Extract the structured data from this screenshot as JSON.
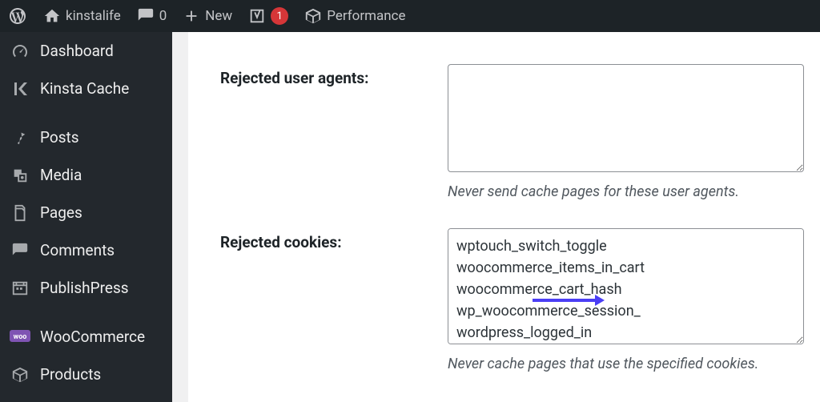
{
  "adminbar": {
    "site_title": "kinstalife",
    "comments_count": "0",
    "new_label": "New",
    "yoast_count": "1",
    "performance_label": "Performance"
  },
  "sidebar": {
    "items": [
      {
        "label": "Dashboard",
        "icon": "dashboard-icon"
      },
      {
        "label": "Kinsta Cache",
        "icon": "kinsta-icon"
      },
      {
        "label": "Posts",
        "icon": "pin-icon"
      },
      {
        "label": "Media",
        "icon": "media-icon"
      },
      {
        "label": "Pages",
        "icon": "pages-icon"
      },
      {
        "label": "Comments",
        "icon": "comment-icon"
      },
      {
        "label": "PublishPress",
        "icon": "publishpress-icon"
      },
      {
        "label": "WooCommerce",
        "icon": "woocommerce-icon"
      },
      {
        "label": "Products",
        "icon": "products-icon"
      }
    ]
  },
  "settings": {
    "rejected_user_agents": {
      "label": "Rejected user agents:",
      "value": "",
      "help": "Never send cache pages for these user agents."
    },
    "rejected_cookies": {
      "label": "Rejected cookies:",
      "value": "wptouch_switch_toggle\nwoocommerce_items_in_cart\nwoocommerce_cart_hash\nwp_woocommerce_session_\nwordpress_logged_in",
      "help": "Never cache pages that use the specified cookies."
    }
  }
}
